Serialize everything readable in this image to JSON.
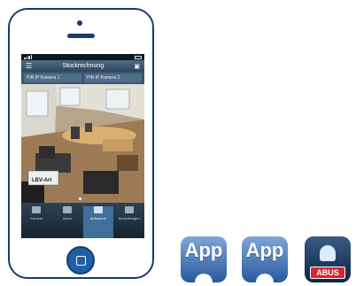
{
  "phone": {
    "screen": {
      "title": "Stockrechnung",
      "tabs": [
        "PIR IP Kamera 1",
        "PIR IP Kamera 2"
      ],
      "camera_label": "LBV-Art",
      "bottom_nav": [
        {
          "label": "Kamera",
          "icon": "camera-icon",
          "active": false
        },
        {
          "label": "Alarm",
          "icon": "alarm-icon",
          "active": false
        },
        {
          "label": "Aufnahme",
          "icon": "recording-icon",
          "active": true
        },
        {
          "label": "Einstellungen",
          "icon": "settings-icon",
          "active": false
        }
      ]
    }
  },
  "apps": [
    {
      "label": "App",
      "platform_icon": "android-icon"
    },
    {
      "label": "App",
      "platform_icon": "apple-icon"
    },
    {
      "label": "ABUS",
      "icon": "abus-alarm-icon"
    }
  ],
  "colors": {
    "phone_outline": "#173b6e",
    "home_button": "#1f5fa6",
    "app_blue": "#2a5a9e",
    "abus_red": "#d7262f"
  }
}
